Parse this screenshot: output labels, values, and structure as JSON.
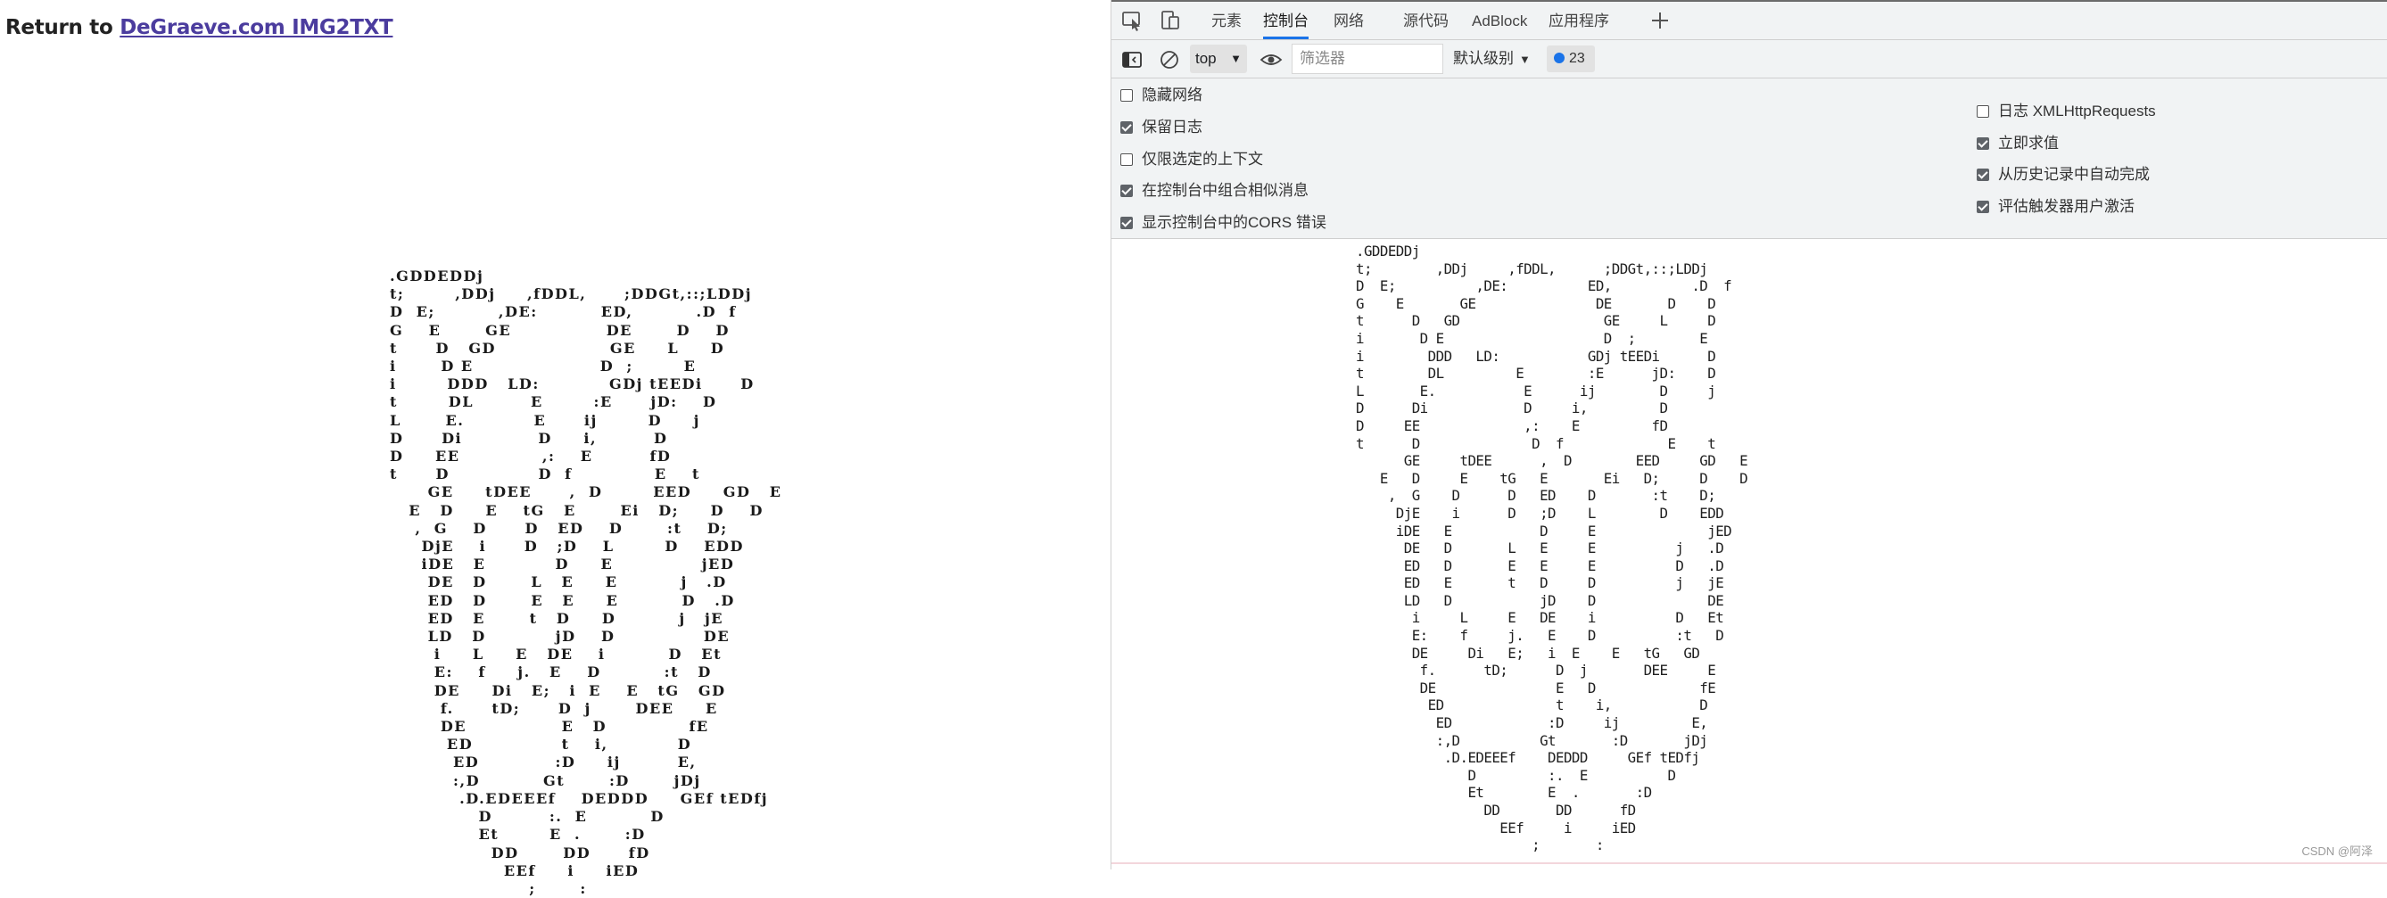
{
  "page": {
    "return_prefix": "Return to ",
    "return_link": "DeGraeve.com IMG2TXT",
    "ascii_art": ".GDDEDDj\nt;        ,DDj     ,fDDL,      ;DDGt,::;LDDj\nD  E;          ,DE:          ED,          .D  f\nG    E       GE               DE       D    D\nt      D   GD                  GE     L     D\ni       D E                    D  ;        E\ni        DDD   LD:           GDj tEEDi      D\nt        DL         E        :E      jD:    D\nL       E.           E      ij        D     j\nD      Di            D     i,         D\nD     EE             ,:    E         fD\nt      D              D  f             E    t\n      GE     tDEE      ,  D        EED     GD   E\n   E   D     E    tG   E       Ei   D;     D    D\n    ,  G    D      D   ED    D       :t    D;\n     DjE    i      D   ;D    L        D    EDD\n     iDE   E           D     E              jED\n      DE   D       L   E     E          j   .D\n      ED   D       E   E     E          D   .D\n      ED   E       t   D     D          j   jE\n      LD   D           jD    D              DE\n       i     L     E   DE    i          D   Et\n       E:    f     j.   E    D          :t   D\n       DE     Di   E;   i  E    E   tG   GD\n        f.      tD;      D  j       DEE     E\n        DE               E   D             fE\n         ED              t    i,           D\n          ED            :D     ij         E,\n          :,D          Gt       :D       jDj\n           .D.EDEEEf    DEDDD     GEf tEDfj\n              D         :.  E          D\n              Et        E  .       :D\n                DD       DD      fD\n                  EEf     i     iED\n                      ;       :",
    "ascii_art_console": ".GDDEDDj\nt;        ,DDj     ,fDDL,      ;DDGt,::;LDDj\nD  E;          ,DE:          ED,          .D  f\nG    E       GE               DE       D    D\nt      D   GD                  GE     L     D\ni       D E                    D  ;        E\ni        DDD   LD:           GDj tEEDi      D\nt        DL         E        :E      jD:    D\nL       E.           E      ij        D     j\nD      Di            D     i,         D\nD     EE             ,:    E         fD\nt      D              D  f             E    t\n      GE     tDEE      ,  D        EED     GD   E\n   E   D     E    tG   E       Ei   D;     D    D\n    ,  G    D      D   ED    D       :t    D;\n     DjE    i      D   ;D    L        D    EDD\n     iDE   E           D     E              jED\n      DE   D       L   E     E          j   .D\n      ED   D       E   E     E          D   .D\n      ED   E       t   D     D          j   jE\n      LD   D           jD    D              DE\n       i     L     E   DE    i          D   Et\n       E:    f     j.   E    D          :t   D\n       DE     Di   E;   i  E    E   tG   GD\n        f.      tD;      D  j       DEE     E\n        DE               E   D             fE\n         ED              t    i,           D\n          ED            :D     ij         E,\n          :,D          Gt       :D       jDj\n           .D.EDEEEf    DEDDD     GEf tEDfj\n              D         :.  E          D\n              Et        E  .       :D\n                DD       DD      fD\n                  EEf     i     iED\n                      ;       :"
  },
  "devtools": {
    "tabs": [
      {
        "label": "元素"
      },
      {
        "label": "控制台"
      },
      {
        "label": "网络"
      },
      {
        "label": "源代码"
      },
      {
        "label": "AdBlock"
      },
      {
        "label": "应用程序"
      }
    ],
    "toolbar": {
      "context": "top",
      "filter_placeholder": "筛选器",
      "level": "默认级别",
      "issues_count": "23"
    },
    "settings": {
      "left": [
        {
          "label": "隐藏网络",
          "checked": false
        },
        {
          "label": "保留日志",
          "checked": true
        },
        {
          "label": "仅限选定的上下文",
          "checked": false
        },
        {
          "label": "在控制台中组合相似消息",
          "checked": true
        },
        {
          "label": "显示控制台中的CORS 错误",
          "checked": true
        }
      ],
      "right": [
        {
          "label": "日志 XMLHttpRequests",
          "checked": false
        },
        {
          "label": "立即求值",
          "checked": true
        },
        {
          "label": "从历史记录中自动完成",
          "checked": true
        },
        {
          "label": "评估触发器用户激活",
          "checked": true
        }
      ]
    },
    "watermark": "CSDN @阿泽"
  },
  "colors": {
    "link": "#4b3c9e",
    "active_tab": "#1a73e8",
    "panel_bg": "#f1f3f4",
    "badge_dot": "#1a73e8"
  }
}
